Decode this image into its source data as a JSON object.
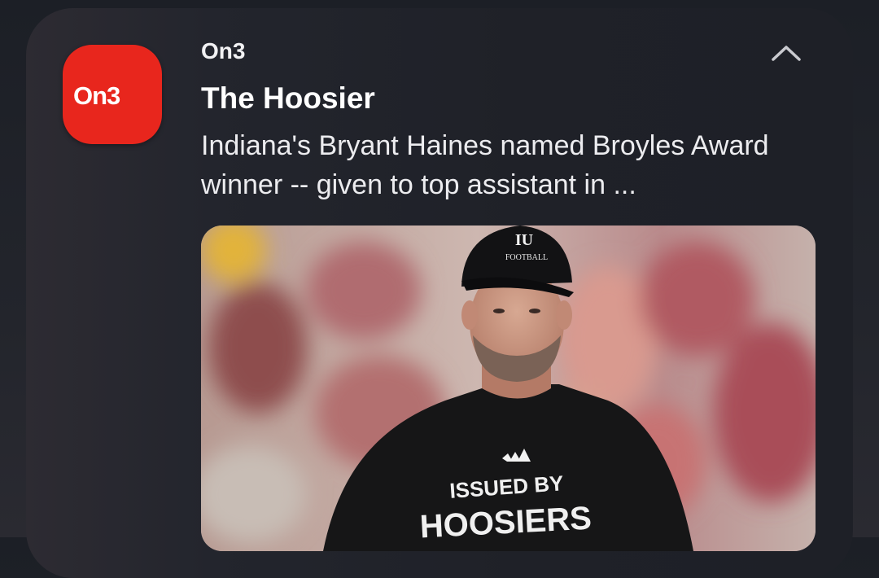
{
  "notification": {
    "app_name": "On3",
    "title": "The Hoosier",
    "body": "Indiana's Bryant Haines named Broyles Award winner -- given to top assistant in ...",
    "collapse_icon": "chevron-up-icon",
    "app_icon": {
      "name": "on3-app-icon",
      "logo_text": "ON3",
      "background": "#e8261d"
    },
    "image": {
      "name": "bryant-haines-photo",
      "cap_logo": "IU",
      "cap_text": "FOOTBALL",
      "shirt_text_line1": "ISSUED BY",
      "shirt_text_line2": "HOOSIERS"
    }
  },
  "colors": {
    "card": "#1f2128",
    "text": "#ffffff",
    "brand_red": "#e8261d"
  }
}
